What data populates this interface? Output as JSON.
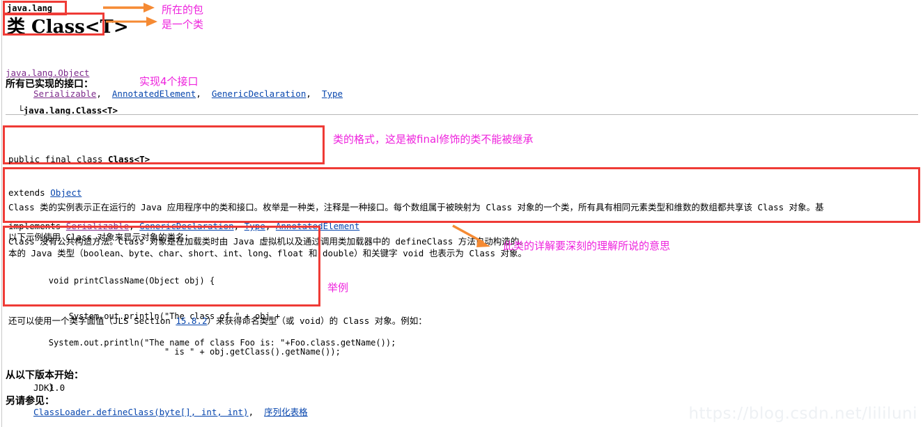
{
  "page": {
    "package_name": "java.lang",
    "class_title": "类 Class<T>",
    "hierarchy": {
      "root": "java.lang.Object",
      "branch_glyph": "└",
      "leaf": "java.lang.Class<T>"
    },
    "interfaces_heading": "所有已实现的接口：",
    "interfaces": [
      "Serializable",
      "AnnotatedElement",
      "GenericDeclaration",
      "Type"
    ],
    "declaration": {
      "line1_prefix": "public final class ",
      "line1_name": "Class<T>",
      "line2_prefix": "extends ",
      "line2_link": "Object",
      "line3_prefix": "implements ",
      "line3_links": [
        "Serializable",
        "GenericDeclaration",
        "Type",
        "AnnotatedElement"
      ]
    },
    "description": {
      "p1_line1": "Class 类的实例表示正在运行的 Java 应用程序中的类和接口。枚举是一种类，注释是一种接口。每个数组属于被映射为 Class 对象的一个类，所有具有相同元素类型和维数的数组都共享该 Class 对象。基",
      "p1_line2": "本的 Java 类型（boolean、byte、char、short、int、long、float 和 double）和关键字 void 也表示为 Class 对象。",
      "p2_line1": "Class 没有公共构造方法。Class 对象是在加载类时由 Java 虚拟机以及通过调用类加载器中的 defineClass 方法自动构造的。"
    },
    "example": {
      "intro": "以下示例使用 Class 对象来显示对象的类名：",
      "code_lines": [
        "        void printClassName(Object obj) {",
        "            System.out.println(\"The class of \" + obj +",
        "                               \" is \" + obj.getClass().getName());",
        "        }"
      ]
    },
    "literal": {
      "before_link": "还可以使用一个类字面值（JLS Section ",
      "link": "15.8.2",
      "after_link": "）来获得命名类型（或 void）的 Class 对象。例如：",
      "code": "        System.out.println(\"The name of class Foo is: \"+Foo.class.getName());"
    },
    "since": {
      "heading": "从以下版本开始：",
      "value": "JDK1.0"
    },
    "see_also": {
      "heading": "另请参见：",
      "links": [
        "ClassLoader.defineClass(byte[], int, int)",
        "序列化表格"
      ],
      "separator": ", "
    },
    "watermark": "https://blog.csdn.net/lililuni"
  },
  "annotations": {
    "package_note": "所在的包",
    "class_note": "是一个类",
    "interfaces_note": "实现4个接口",
    "declaration_note": "类的格式，这是被final修饰的类不能被继承",
    "description_note": "此类的详解要深刻的理解所说的意思",
    "example_note": "举例"
  },
  "colors": {
    "annotation_box": "#ef3b36",
    "annotation_text": "#ee22dd",
    "arrow": "#f58a33",
    "link": "#0645ad",
    "link_visited": "#7d2b8b",
    "rule": "#b7b7b7",
    "watermark": "#eef1f4"
  }
}
